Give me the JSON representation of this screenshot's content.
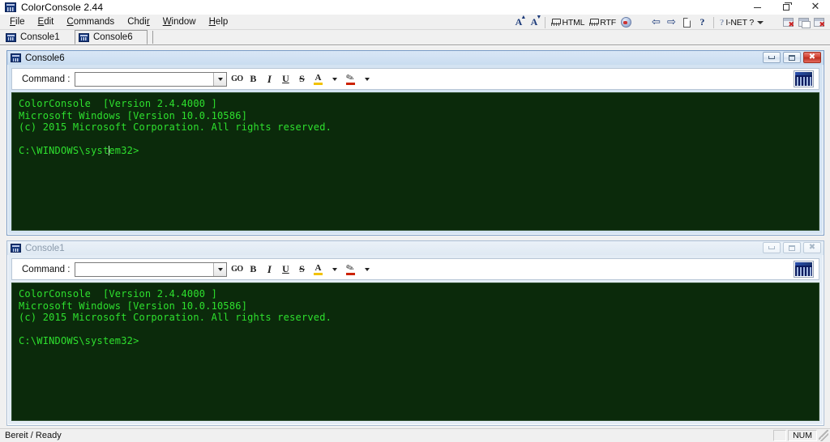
{
  "app": {
    "title": "ColorConsole 2.44",
    "icon": "console-app-icon"
  },
  "window_controls": {
    "minimize": "minimize",
    "restore": "restore",
    "close": "close"
  },
  "menu": {
    "items": [
      {
        "label": "File",
        "accel": "F"
      },
      {
        "label": "Edit",
        "accel": "E"
      },
      {
        "label": "Commands",
        "accel": "C"
      },
      {
        "label": "Chdir",
        "accel": "r"
      },
      {
        "label": "Window",
        "accel": "W"
      },
      {
        "label": "Help",
        "accel": "H"
      }
    ]
  },
  "toolbar": {
    "items": [
      {
        "name": "increase-font-size-button",
        "label": "A",
        "sup": "+",
        "icon": "font-larger-icon"
      },
      {
        "name": "decrease-font-size-button",
        "label": "A",
        "sup": "-",
        "icon": "font-smaller-icon"
      },
      {
        "name": "separator-1",
        "icon": "separator"
      },
      {
        "name": "export-html-button",
        "label": "HTML",
        "icon": "html-tag-icon"
      },
      {
        "name": "export-rtf-button",
        "label": "RTF",
        "icon": "rtf-tag-icon"
      },
      {
        "name": "colors-button",
        "label": "",
        "icon": "color-globe-icon"
      },
      {
        "name": "back-button",
        "label": "",
        "icon": "arrow-left-icon"
      },
      {
        "name": "forward-button",
        "label": "",
        "icon": "arrow-right-icon"
      },
      {
        "name": "new-page-button",
        "label": "",
        "icon": "page-icon"
      },
      {
        "name": "help-button",
        "label": "",
        "icon": "question-mark-icon"
      },
      {
        "name": "separator-2",
        "icon": "separator"
      },
      {
        "name": "inet-button",
        "label": "I-NET ?",
        "icon": "inet-icon"
      },
      {
        "name": "close-window-button",
        "label": "",
        "icon": "window-close-icon"
      },
      {
        "name": "tile-windows-button",
        "label": "",
        "icon": "window-tile-icon"
      },
      {
        "name": "close-all-windows-button",
        "label": "",
        "icon": "window-close-all-icon"
      }
    ]
  },
  "tabs": {
    "items": [
      {
        "label": "Console1",
        "active": false,
        "icon": "console-tab-icon"
      },
      {
        "label": "Console6",
        "active": true,
        "icon": "console-tab-icon"
      }
    ]
  },
  "consoles": [
    {
      "title": "Console6",
      "active": true,
      "command": {
        "label": "Command :",
        "value": "",
        "placeholder": ""
      },
      "format_tools": [
        {
          "name": "go-button",
          "label": "GO",
          "icon": "go-icon"
        },
        {
          "name": "bold-button",
          "label": "B",
          "icon": "bold-icon"
        },
        {
          "name": "italic-button",
          "label": "I",
          "icon": "italic-icon"
        },
        {
          "name": "underline-button",
          "label": "U",
          "icon": "underline-icon"
        },
        {
          "name": "strikethrough-button",
          "label": "S",
          "icon": "strikethrough-icon"
        },
        {
          "name": "font-color-button",
          "label": "A",
          "icon": "font-color-icon",
          "color": "#f2c200"
        },
        {
          "name": "highlight-button",
          "label": "",
          "icon": "highlight-pen-icon",
          "color": "#cc2200"
        }
      ],
      "console_icon": "terminal-icon",
      "lines": [
        "ColorConsole  [Version 2.4.4000 ]",
        "Microsoft Windows [Version 10.0.10586]",
        "(c) 2015 Microsoft Corporation. All rights reserved.",
        "",
        "C:\\WINDOWS\\system32>"
      ],
      "cursor_line_index": 4,
      "cursor_col": 15,
      "colors": {
        "background": "#0b2a0b",
        "text": "#2ee02e"
      }
    },
    {
      "title": "Console1",
      "active": false,
      "command": {
        "label": "Command :",
        "value": "",
        "placeholder": ""
      },
      "format_tools": [
        {
          "name": "go-button",
          "label": "GO",
          "icon": "go-icon"
        },
        {
          "name": "bold-button",
          "label": "B",
          "icon": "bold-icon"
        },
        {
          "name": "italic-button",
          "label": "I",
          "icon": "italic-icon"
        },
        {
          "name": "underline-button",
          "label": "U",
          "icon": "underline-icon"
        },
        {
          "name": "strikethrough-button",
          "label": "S",
          "icon": "strikethrough-icon"
        },
        {
          "name": "font-color-button",
          "label": "A",
          "icon": "font-color-icon",
          "color": "#f2c200"
        },
        {
          "name": "highlight-button",
          "label": "",
          "icon": "highlight-pen-icon",
          "color": "#cc2200"
        }
      ],
      "console_icon": "terminal-icon",
      "lines": [
        "ColorConsole  [Version 2.4.4000 ]",
        "Microsoft Windows [Version 10.0.10586]",
        "(c) 2015 Microsoft Corporation. All rights reserved.",
        "",
        "C:\\WINDOWS\\system32>"
      ],
      "cursor_line_index": -1,
      "cursor_col": 0,
      "colors": {
        "background": "#0b2a0b",
        "text": "#2ee02e"
      }
    }
  ],
  "statusbar": {
    "message": "Bereit / Ready",
    "indicators": [
      "",
      "NUM"
    ]
  },
  "palette": {
    "console_bg": "#0b2a0b",
    "console_fg": "#2ee02e",
    "title_active": "#d9e7f6",
    "title_inactive": "#eaf1f8",
    "chrome": "#f0f0f0",
    "accent_blue": "#16377a"
  }
}
